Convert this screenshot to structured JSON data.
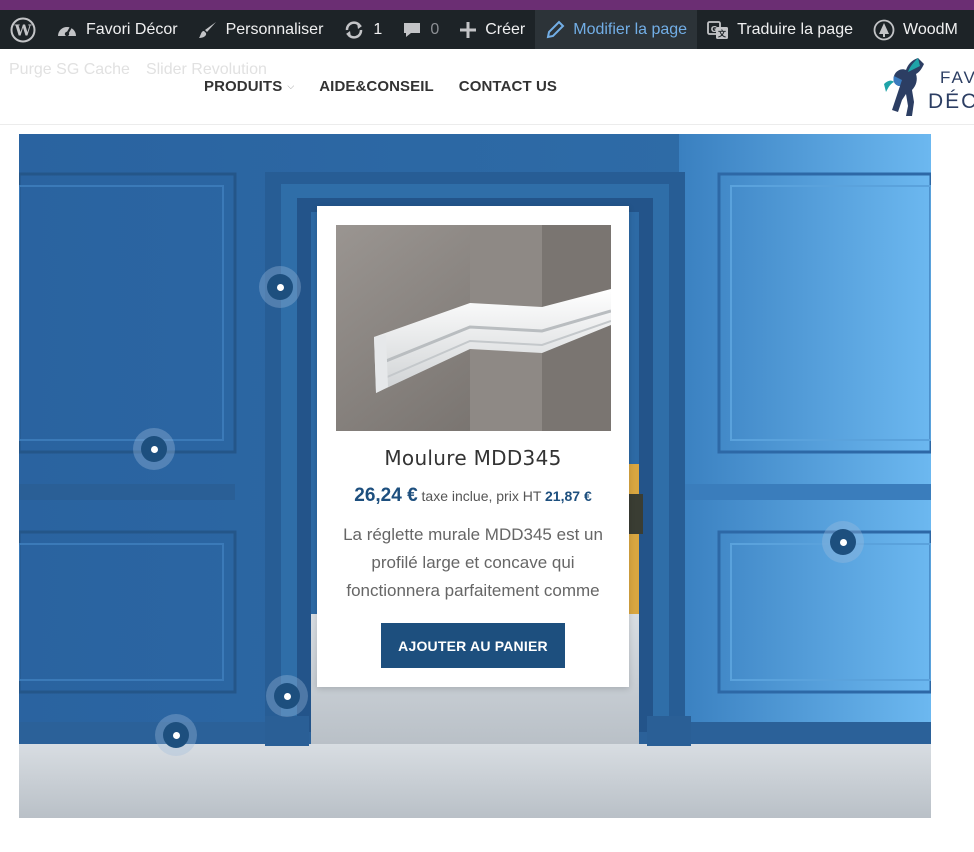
{
  "admin_bar": {
    "site_name": "Favori Décor",
    "customize": "Personnaliser",
    "updates_count": "1",
    "comments_count": "0",
    "new_label": "Créer",
    "edit_page": "Modifier la page",
    "translate_page": "Traduire la page",
    "woodmart": "WoodM",
    "colors": {
      "bar": "#1d2327",
      "active_text": "#72aee6"
    }
  },
  "header": {
    "ghost_links": [
      "Purge SG Cache",
      "Slider Revolution"
    ],
    "nav": [
      {
        "label": "PRODUITS",
        "has_dropdown": true
      },
      {
        "label": "AIDE&CONSEIL",
        "has_dropdown": false
      },
      {
        "label": "CONTACT US",
        "has_dropdown": false
      }
    ],
    "logo_line1": "FAV",
    "logo_line2": "DÉC"
  },
  "hero": {
    "product": {
      "title": "Moulure MDD345",
      "price": "26,24 €",
      "tax_note": "taxe inclue, prix HT",
      "price_ht": "21,87 €",
      "description": "La réglette murale MDD345 est un profilé large et concave qui fonctionnera parfaitement comme",
      "button": "AJOUTER AU PANIER"
    },
    "hotspot_count": 5,
    "colors": {
      "accent": "#1d4f7e",
      "wall": "#2f6ea8"
    }
  }
}
